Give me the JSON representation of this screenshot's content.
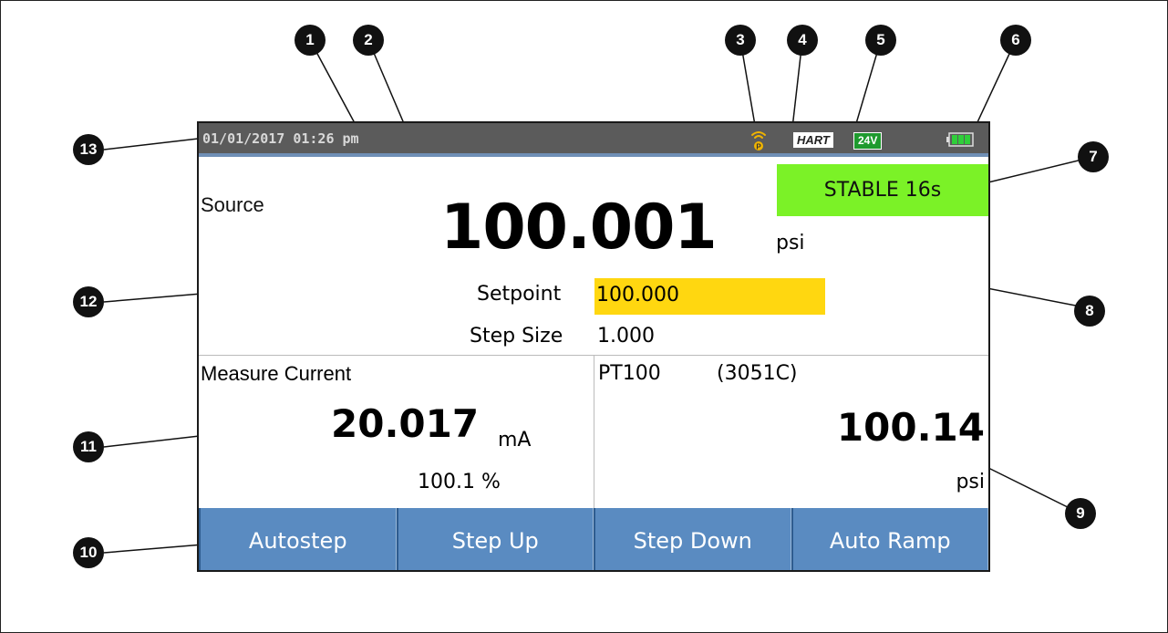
{
  "callouts": [
    "1",
    "2",
    "3",
    "4",
    "5",
    "6",
    "7",
    "8",
    "9",
    "10",
    "11",
    "12",
    "13"
  ],
  "status_bar": {
    "datetime": "01/01/2017 01:26 pm",
    "hart_badge": "HART",
    "loop_power_badge": "24V",
    "icons": [
      "wireless-icon",
      "battery-icon"
    ]
  },
  "source": {
    "label": "Source",
    "stability": "STABLE 16s",
    "value": "100.001",
    "unit": "psi",
    "setpoint_label": "Setpoint",
    "setpoint_value": "100.000",
    "step_size_label": "Step Size",
    "step_size_value": "1.000"
  },
  "measure": {
    "label": "Measure Current",
    "value": "20.017",
    "unit": "mA",
    "percent": "100.1 %"
  },
  "pt": {
    "label": "PT100",
    "device": "(3051C)",
    "value": "100.14",
    "unit": "psi"
  },
  "softkeys": [
    "Autostep",
    "Step Up",
    "Step Down",
    "Auto Ramp"
  ],
  "colors": {
    "status_bar": "#5b5b5b",
    "stable": "#7bf227",
    "setpoint_highlight": "#ffd710",
    "softkey": "#5a8bc1",
    "hart_24v": "#1e9a2e"
  }
}
